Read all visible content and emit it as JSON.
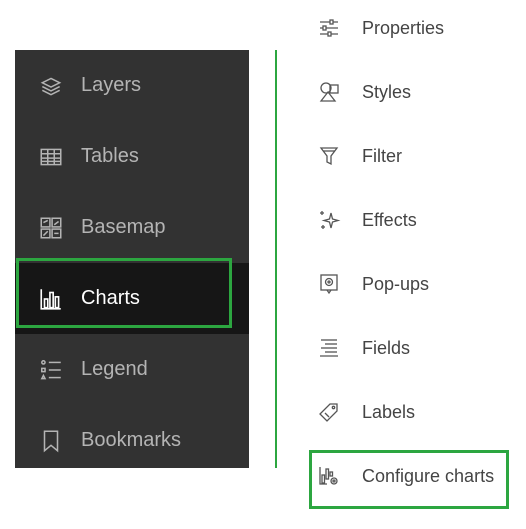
{
  "left_nav": {
    "items": [
      {
        "label": "Layers",
        "icon": "layers-icon"
      },
      {
        "label": "Tables",
        "icon": "table-icon"
      },
      {
        "label": "Basemap",
        "icon": "basemap-icon"
      },
      {
        "label": "Charts",
        "icon": "chart-icon",
        "active": true
      },
      {
        "label": "Legend",
        "icon": "legend-icon"
      },
      {
        "label": "Bookmarks",
        "icon": "bookmark-icon"
      }
    ]
  },
  "right_menu": {
    "items": [
      {
        "label": "Properties",
        "icon": "sliders-icon"
      },
      {
        "label": "Styles",
        "icon": "shapes-icon"
      },
      {
        "label": "Filter",
        "icon": "filter-icon"
      },
      {
        "label": "Effects",
        "icon": "sparkle-icon"
      },
      {
        "label": "Pop-ups",
        "icon": "popup-icon"
      },
      {
        "label": "Fields",
        "icon": "fields-icon"
      },
      {
        "label": "Labels",
        "icon": "label-tag-icon"
      },
      {
        "label": "Configure charts",
        "icon": "configure-chart-icon",
        "highlighted": true
      }
    ]
  },
  "colors": {
    "panel_bg": "#323232",
    "active_bg": "#161616",
    "highlight": "#2ca640",
    "left_text": "#b4b4b4",
    "right_text": "#444444"
  }
}
